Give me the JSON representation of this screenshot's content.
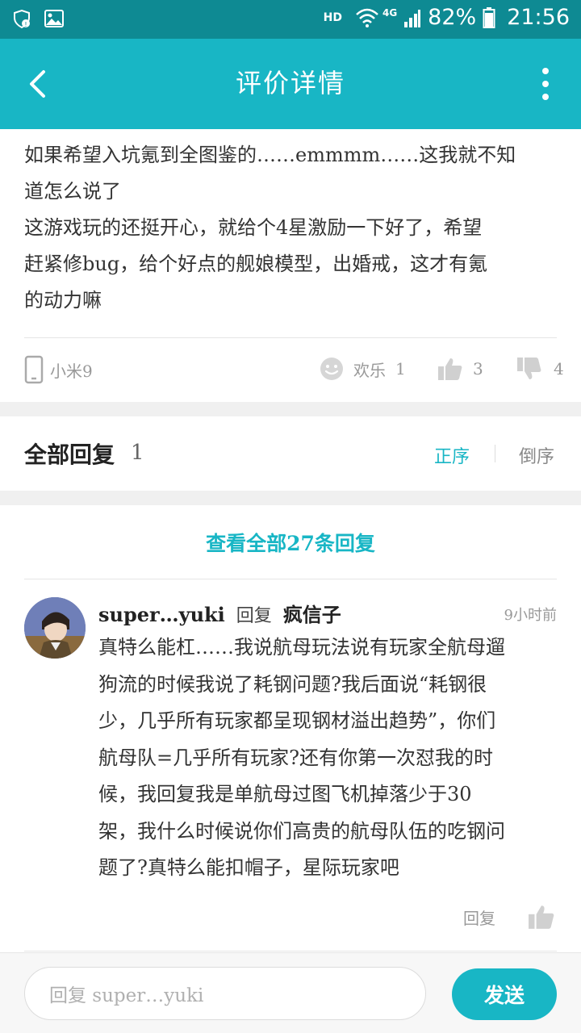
{
  "status_bar": {
    "network": "HD",
    "signal": "4G",
    "battery": "82%",
    "time": "21:56"
  },
  "header": {
    "title": "评价详情",
    "back_icon": "back-arrow-icon",
    "more_icon": "more-vertical-icon"
  },
  "review": {
    "lines": [
      "如果希望入坑氪到全图鉴的……emmmm……这我就不知",
      "道怎么说了",
      "这游戏玩的还挺开心，就给个4星激励一下好了，希望",
      "赶紧修bug，给个好点的舰娘模型，出婚戒，这才有氪",
      "的动力嘛"
    ],
    "device": "小米9",
    "mood_label": "欢乐",
    "mood_count": "1",
    "like_count": "3",
    "dislike_count": "4"
  },
  "replies_section": {
    "title": "全部回复",
    "count": "1",
    "sort_asc": "正序",
    "sort_desc": "倒序",
    "view_all": "查看全部27条回复"
  },
  "reply": {
    "user": "super…yuki",
    "verb": "回复",
    "target": "疯信子",
    "time": "9小时前",
    "lines": [
      "真特么能杠……我说航母玩法说有玩家全航母遛",
      "狗流的时候我说了耗钢问题?我后面说“耗钢很",
      "少，几乎所有玩家都呈现钢材溢出趋势”，你们",
      "航母队=几乎所有玩家?还有你第一次怼我的时",
      "候，我回复我是单航母过图飞机掉落少于30",
      "架，我什么时候说你们高贵的航母队伍的吃钢问",
      "题了?真特么能扣帽子，星际玩家吧"
    ],
    "action_label": "回复"
  },
  "composer": {
    "placeholder": "回复 super…yuki",
    "send_label": "发送"
  },
  "colors": {
    "accent": "#18b6c5",
    "status_bar": "#0e8a93"
  }
}
